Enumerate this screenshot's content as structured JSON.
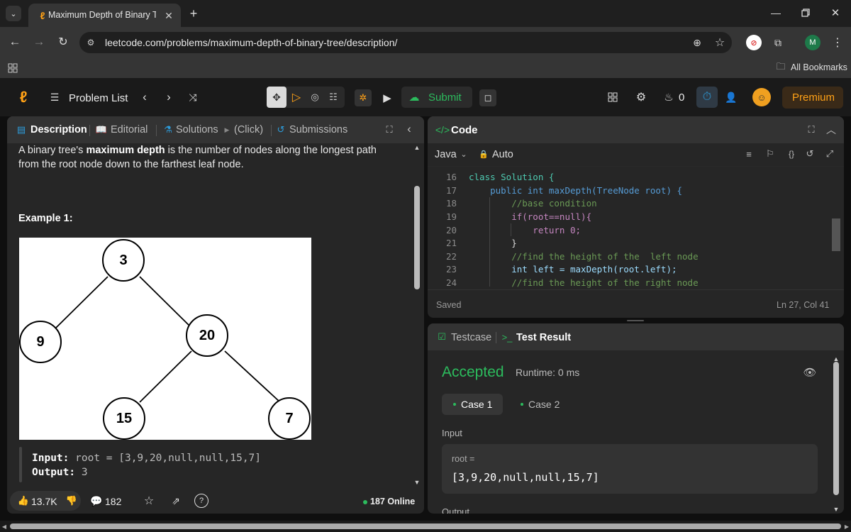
{
  "browser": {
    "tab_title": "Maximum Depth of Binary Tree",
    "url": "leetcode.com/problems/maximum-depth-of-binary-tree/description/",
    "profile_initial": "M",
    "bookmarks_label": "All Bookmarks"
  },
  "nav": {
    "problem_list": "Problem List",
    "submit": "Submit",
    "streak": "0",
    "premium": "Premium"
  },
  "left": {
    "tabs": {
      "description": "Description",
      "editorial": "Editorial",
      "solutions": "Solutions",
      "click": "(Click)",
      "submissions": "Submissions"
    },
    "intro_part1": "A binary tree's ",
    "intro_bold": "maximum depth",
    "intro_part2": " is the number of nodes along the longest path",
    "intro_line2": "from the root node down to the farthest leaf node.",
    "example_title": "Example 1:",
    "tree": {
      "n1": "3",
      "n2": "9",
      "n3": "20",
      "n4": "15",
      "n5": "7"
    },
    "input_label": "Input:",
    "input_value": "root = [3,9,20,null,null,15,7]",
    "output_label": "Output:",
    "output_value": "3",
    "likes": "13.7K",
    "comments": "182",
    "online": "187 Online"
  },
  "code": {
    "title": "Code",
    "language": "Java",
    "mode": "Auto",
    "saved": "Saved",
    "cursor": "Ln 27, Col 41",
    "line_numbers": [
      "16",
      "17",
      "18",
      "19",
      "20",
      "21",
      "22",
      "23",
      "24"
    ],
    "lines": [
      "class Solution {",
      "    public int maxDepth(TreeNode root) {",
      "        //base condition",
      "        if(root==null){",
      "            return 0;",
      "        }",
      "        //find the height of the  left node",
      "        int left = maxDepth(root.left);",
      "        //find the height of the right node"
    ]
  },
  "result": {
    "tab_testcase": "Testcase",
    "tab_result": "Test Result",
    "status": "Accepted",
    "runtime": "Runtime: 0 ms",
    "case1": "Case 1",
    "case2": "Case 2",
    "input_label": "Input",
    "var_label": "root =",
    "var_value": "[3,9,20,null,null,15,7]",
    "output_label": "Output"
  },
  "colors": {
    "accent": "#ffa116",
    "accepted": "#2cbb5d",
    "blue": "#2d9cdb"
  }
}
